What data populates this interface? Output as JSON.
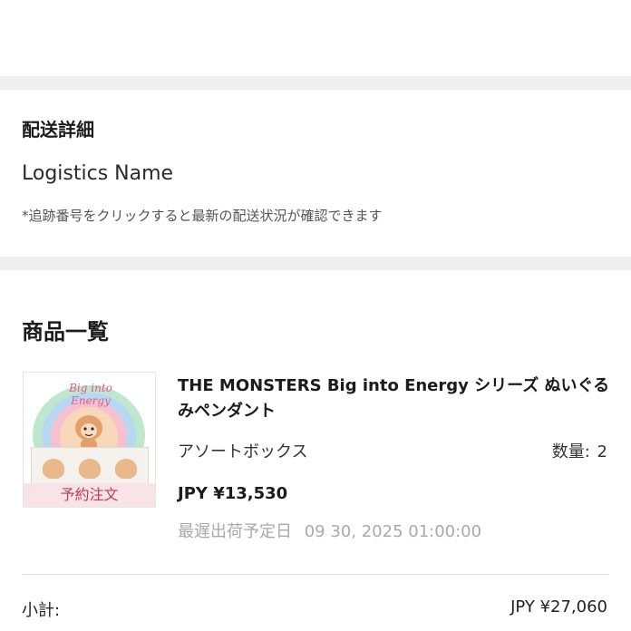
{
  "shipping": {
    "title": "配送詳細",
    "logistics_name": "Logistics Name",
    "tracking_note": "*追跡番号をクリックすると最新の配送状況が確認できます"
  },
  "items_section": {
    "title": "商品一覧",
    "items": [
      {
        "name": "THE MONSTERS Big into Energy シリーズ ぬいぐるみペンダント",
        "variant": "アソートボックス",
        "quantity_label": "数量:",
        "quantity": "2",
        "price": "JPY ¥13,530",
        "ship_date_label": "最遅出荷予定日",
        "ship_date": "09 30, 2025 01:00:00",
        "badge": "予約注文",
        "thumbnail_logo": "Big into Energy"
      }
    ]
  },
  "summary": {
    "subtotal_label": "小計:",
    "subtotal_value": "JPY ¥27,060"
  },
  "colors": {
    "page_background": "#efefef",
    "card_background": "#ffffff",
    "muted_text": "#a9a9a9",
    "badge_text": "#c23b57"
  }
}
